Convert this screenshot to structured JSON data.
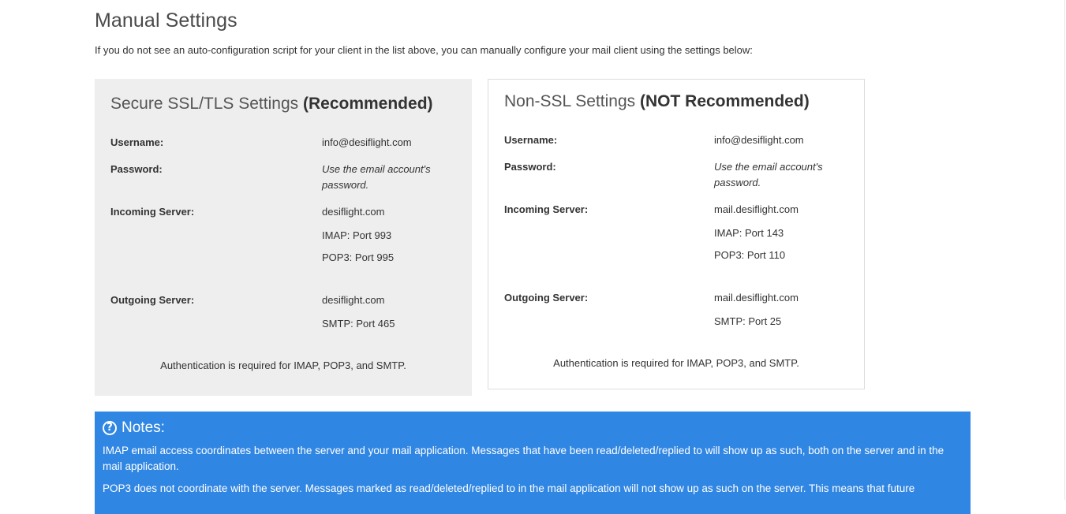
{
  "page": {
    "title": "Manual Settings",
    "intro": "If you do not see an auto-configuration script for your client in the list above, you can manually configure your mail client using the settings below:"
  },
  "secure": {
    "title_light": "Secure SSL/TLS Settings",
    "title_bold": "(Recommended)",
    "username_label": "Username:",
    "username_value": "info@desiflight.com",
    "password_label": "Password:",
    "password_value": "Use the email account's password.",
    "incoming_label": "Incoming Server:",
    "incoming_host": "desiflight.com",
    "incoming_imap": "IMAP: Port 993",
    "incoming_pop3": "POP3: Port 995",
    "outgoing_label": "Outgoing Server:",
    "outgoing_host": "desiflight.com",
    "outgoing_smtp": "SMTP: Port 465",
    "auth_note": "Authentication is required for IMAP, POP3, and SMTP."
  },
  "nonssl": {
    "title_light": "Non-SSL Settings",
    "title_bold": "(NOT Recommended)",
    "username_label": "Username:",
    "username_value": "info@desiflight.com",
    "password_label": "Password:",
    "password_value": "Use the email account's password.",
    "incoming_label": "Incoming Server:",
    "incoming_host": "mail.desiflight.com",
    "incoming_imap": "IMAP: Port 143",
    "incoming_pop3": "POP3: Port 110",
    "outgoing_label": "Outgoing Server:",
    "outgoing_host": "mail.desiflight.com",
    "outgoing_smtp": "SMTP: Port 25",
    "auth_note": "Authentication is required for IMAP, POP3, and SMTP."
  },
  "notes": {
    "icon": "question-circle-icon",
    "heading": "Notes:",
    "imap_note": "IMAP email access coordinates between the server and your mail application. Messages that have been read/deleted/replied to will show up as such, both on the server and in the mail application.",
    "pop3_note": "POP3 does not coordinate with the server. Messages marked as read/deleted/replied to in the mail application will not show up as such on the server. This means that future"
  },
  "colors": {
    "notes_background": "#3086e3",
    "secure_panel_background": "#eeeeee",
    "nonssl_panel_border": "#dddddd"
  }
}
